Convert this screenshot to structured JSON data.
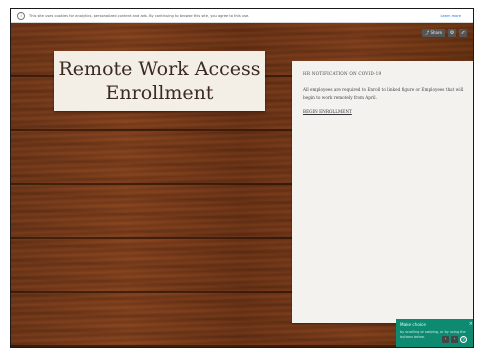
{
  "cookie_bar": {
    "text": "This site uses cookies for analytics, personalized content and ads. By continuing to browse this site, you agree to this use.",
    "link": "Learn more"
  },
  "toolbar": {
    "share_label": "Share",
    "settings_icon": "gear-icon",
    "expand_icon": "expand-icon"
  },
  "title_card": {
    "title": "Remote Work Access\nEnrollment"
  },
  "notice": {
    "heading": "HR NOTIFICATION ON COVID-19",
    "body": "All employees are required to Enroll to linked figure or Employees that will begin to work remotely from April.",
    "link": "BEGIN ENROLLMENT"
  },
  "toast": {
    "title": "Make choice",
    "message": "by scrolling or swiping, or by using the buttons below.",
    "close": "×"
  },
  "controls": {
    "icons": [
      "prev-icon",
      "next-icon",
      "help-icon"
    ]
  },
  "colors": {
    "wood": "#7a3b18",
    "toast": "#0e8a70",
    "card": "#f3eee6"
  }
}
